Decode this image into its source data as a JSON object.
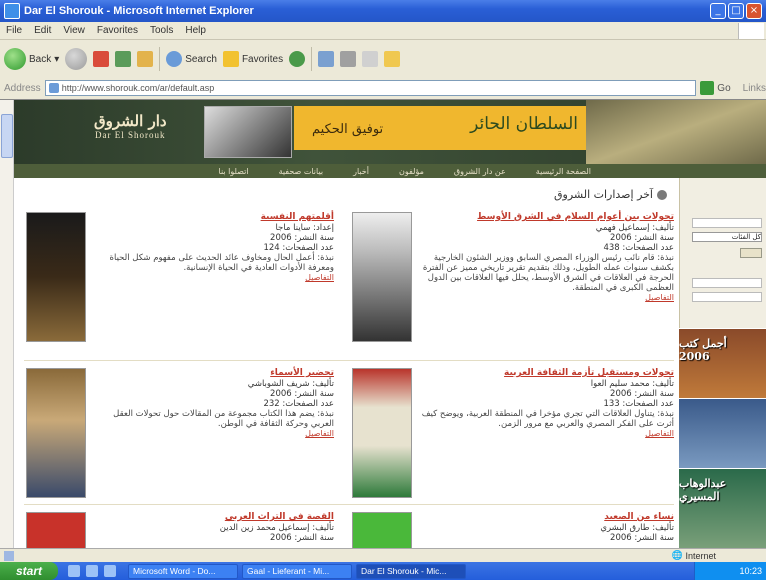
{
  "window": {
    "title": "Dar El Shorouk - Microsoft Internet Explorer",
    "controls": {
      "minimize": "_",
      "maximize": "□",
      "close": "×"
    }
  },
  "menu": [
    "File",
    "Edit",
    "View",
    "Favorites",
    "Tools",
    "Help"
  ],
  "toolbar": {
    "back": "Back",
    "search": "Search",
    "favorites": "Favorites"
  },
  "address": {
    "label": "Address",
    "url": "http://www.shorouk.com/ar/default.asp",
    "go": "Go",
    "links": "Links"
  },
  "site": {
    "logo_ar": "دار الشروق",
    "logo_en": "Dar El Shorouk",
    "banner_title": "السلطان الحائر",
    "banner_author": "توفيق الحكيم",
    "nav": [
      "الصفحة الرئيسية",
      "عن دار الشروق",
      "مؤلفون",
      "أخبار",
      "بيانات صحفية",
      "اتصلوا بنا"
    ],
    "section_title": "آخر إصدارات الشروق"
  },
  "books": [
    {
      "title": "تحولات بين أعوام السلام في الشرق الأوسط",
      "author": "تأليف: إسماعيل فهمي",
      "year": "سنة النشر: 2006",
      "pages": "عدد الصفحات: 438",
      "desc": "نبذة: قام نائب رئيس الوزراء المصري السابق ووزير الشئون الخارجية بكشف سنوات عمله الطويل، وذلك بتقديم تقرير تاريخي مميز عن الفترة الحرجة في العلاقات في الشرق الأوسط، يحلل فيها العلاقات بين الدول العظمى الكبرى في المنطقة.",
      "more": "التفاصيل"
    },
    {
      "title": "أقلمتهم النفسية",
      "author": "إعداد: ساينا ماجا",
      "year": "سنة النشر: 2006",
      "pages": "عدد الصفحات: 124",
      "desc": "نبذة: أعمل الحال ومخاوف عائد الحديث على مفهوم شكل الحياة ومعرفة الأدوات العادية في الحياة الإنسانية.",
      "more": "التفاصيل"
    },
    {
      "title": "تحولات ومستقبل تأزمة الثقافة العربية",
      "author": "تأليف: محمد سليم العوا",
      "year": "سنة النشر: 2006",
      "pages": "عدد الصفحات: 133",
      "desc": "نبذة: يتناول العلاقات التي تجري مؤخرا في المنطقة العربية، ويوضح كيف أثرت على الفكر المصري والعربي مع مرور الزمن.",
      "more": "التفاصيل"
    },
    {
      "title": "تحضير الأسماء",
      "author": "تأليف: شريف الشوباشي",
      "year": "سنة النشر: 2006",
      "pages": "عدد الصفحات: 232",
      "desc": "نبذة: يضم هذا الكتاب مجموعة من المقالات حول تحولات العقل العربي وحركة الثقافة في الوطن.",
      "more": "التفاصيل"
    },
    {
      "title": "نساء من الصعيد",
      "author": "تأليف: طارق البشري",
      "year": "سنة النشر: 2006",
      "pages": "",
      "desc": "",
      "more": ""
    },
    {
      "title": "القصة في التراث العربي",
      "author": "تأليف: إسماعيل محمد زين الدين",
      "year": "سنة النشر: 2006",
      "pages": "",
      "desc": "",
      "more": ""
    }
  ],
  "sidebar": {
    "select_value": "كل الفئات",
    "promos": [
      "أجمل كتب 2006",
      "عبدالوهاب المسيري"
    ]
  },
  "status": {
    "zone": "Internet"
  },
  "taskbar": {
    "start": "start",
    "tasks": [
      "Microsoft Word - Do...",
      "Gaal - Lieferant - Mi...",
      "Dar El Shorouk - Mic..."
    ],
    "clock": "10:23"
  }
}
